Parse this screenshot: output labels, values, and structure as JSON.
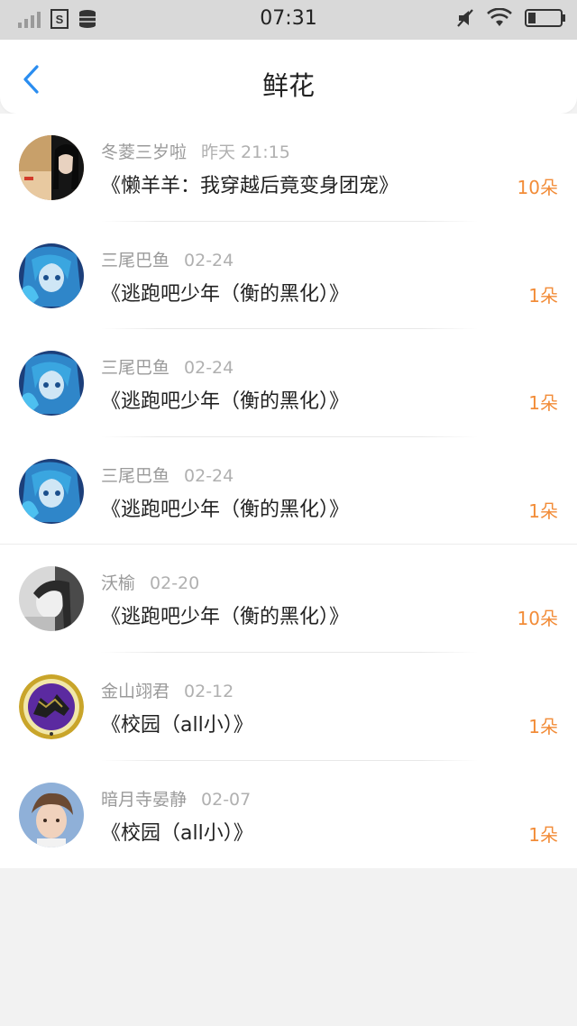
{
  "status_bar": {
    "time": "07:31",
    "left_icons": [
      "signal-icon",
      "sim-s-icon",
      "database-icon"
    ],
    "right_icons": [
      "mute-icon",
      "wifi-icon",
      "battery-icon"
    ]
  },
  "nav": {
    "title": "鲜花",
    "back_icon": "chevron-left-icon"
  },
  "colors": {
    "accent_blue": "#2a8df0",
    "count_orange": "#f28c38"
  },
  "items": [
    {
      "user": "冬菱三岁啦",
      "date": "昨天 21:15",
      "book": "《懒羊羊：我穿越后竟变身团宠》",
      "count": "10朵",
      "avatar": "photo-avatar"
    },
    {
      "user": "三尾巴鱼",
      "date": "02-24",
      "book": "《逃跑吧少年（衡的黑化）》",
      "count": "1朵",
      "avatar": "anime-avatar"
    },
    {
      "user": "三尾巴鱼",
      "date": "02-24",
      "book": "《逃跑吧少年（衡的黑化）》",
      "count": "1朵",
      "avatar": "anime-avatar"
    },
    {
      "user": "三尾巴鱼",
      "date": "02-24",
      "book": "《逃跑吧少年（衡的黑化）》",
      "count": "1朵",
      "avatar": "anime-avatar"
    },
    {
      "user": "沃榆",
      "date": "02-20",
      "book": "《逃跑吧少年（衡的黑化）》",
      "count": "10朵",
      "avatar": "grayscale-avatar"
    },
    {
      "user": "金山翊君",
      "date": "02-12",
      "book": "《校园（all小）》",
      "count": "1朵",
      "avatar": "emblem-avatar"
    },
    {
      "user": "暗月寺晏静",
      "date": "02-07",
      "book": "《校园（all小）》",
      "count": "1朵",
      "avatar": "portrait-avatar"
    }
  ]
}
